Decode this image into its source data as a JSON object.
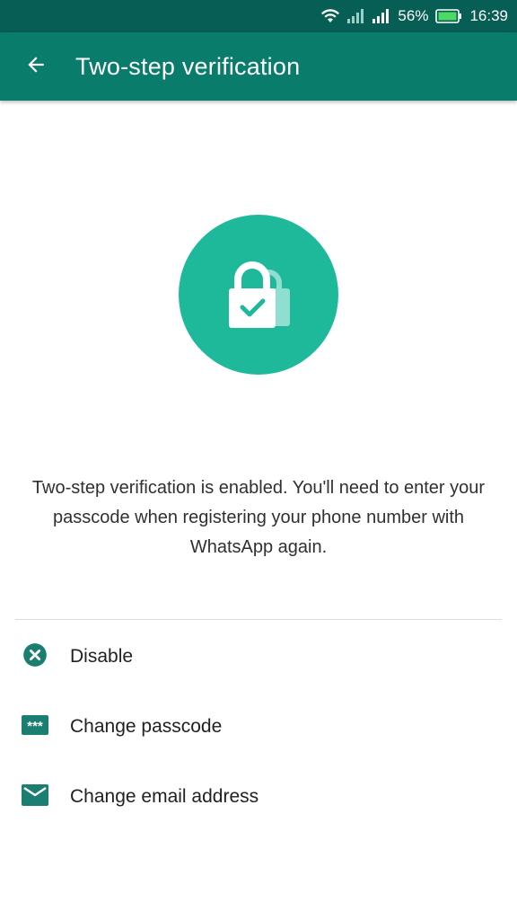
{
  "status_bar": {
    "battery_percent": "56%",
    "time": "16:39"
  },
  "app_bar": {
    "title": "Two-step verification",
    "back_icon": "arrow-back-icon"
  },
  "hero": {
    "icon": "lock-check-icon",
    "color": "#1eb99a"
  },
  "description": "Two-step verification is enabled. You'll need to enter your passcode when registering your phone number with WhatsApp again.",
  "options": [
    {
      "label": "Disable",
      "icon": "cancel-circle-icon"
    },
    {
      "label": "Change passcode",
      "icon": "passcode-icon"
    },
    {
      "label": "Change email address",
      "icon": "email-icon"
    }
  ],
  "colors": {
    "primary_dark": "#075e54",
    "primary": "#0a7c6c",
    "accent": "#1eb99a",
    "icon": "#1a7f70"
  }
}
